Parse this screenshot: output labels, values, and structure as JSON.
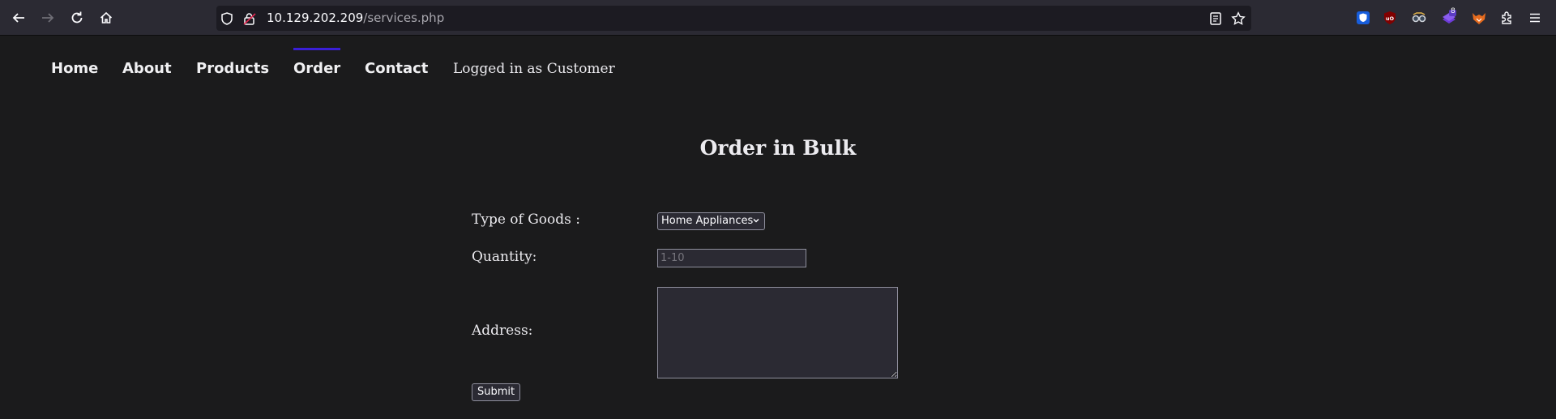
{
  "browser": {
    "url_host": "10.129.202.209",
    "url_path": "/services.php",
    "extension_badge": "8"
  },
  "nav": {
    "items": [
      "Home",
      "About",
      "Products",
      "Order",
      "Contact"
    ],
    "active": "Order",
    "status": "Logged in as Customer",
    "active_color": "#3a1fd6"
  },
  "form": {
    "title": "Order in Bulk",
    "goods_label": "Type of Goods :",
    "goods_selected": "Home Appliances",
    "quantity_label": "Quantity:",
    "quantity_placeholder": "1-10",
    "quantity_value": "",
    "address_label": "Address:",
    "address_value": "",
    "submit_label": "Submit"
  }
}
